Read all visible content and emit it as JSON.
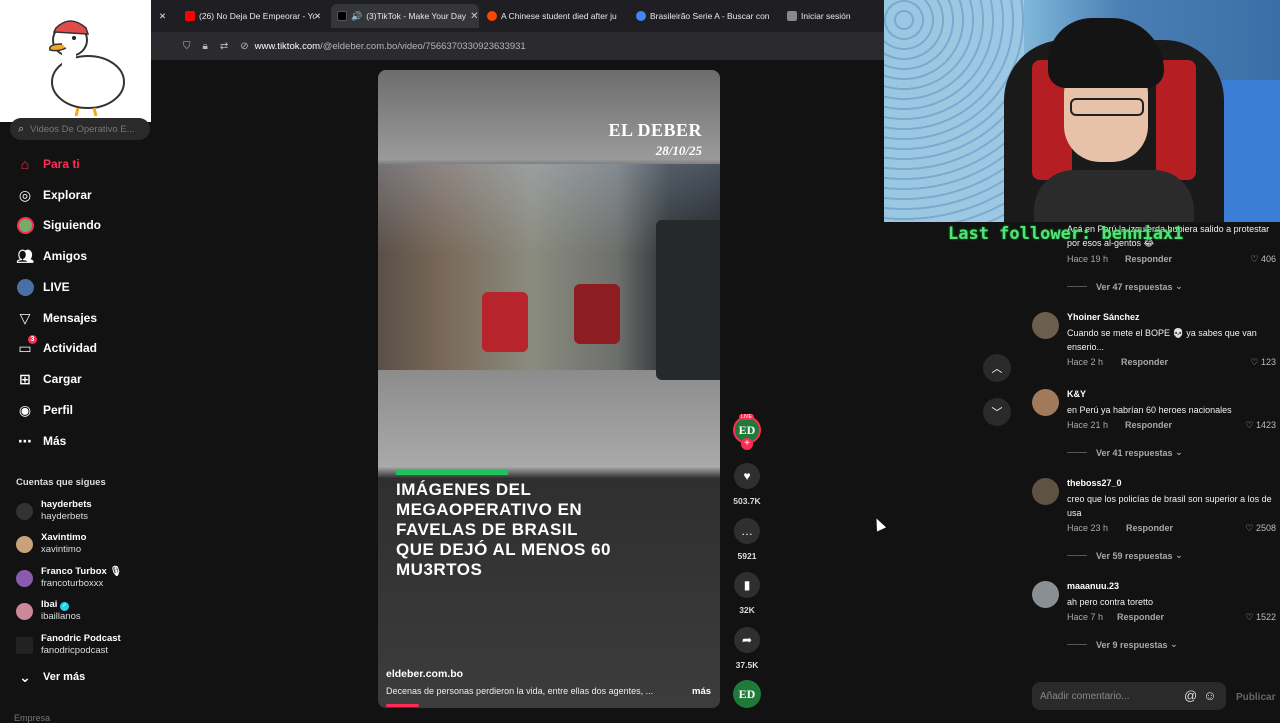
{
  "browser": {
    "tabs": [
      {
        "label": "(26) No Deja De Empeorar - Yo",
        "icon": "youtube-icon",
        "color": "#ff0000"
      },
      {
        "label": "(3)TikTok - Make Your Day",
        "icon": "tiktok-icon",
        "color": "#000000",
        "active": true
      },
      {
        "label": "A Chinese student died after ju",
        "icon": "reddit-icon",
        "color": "#ff4500"
      },
      {
        "label": "Brasileirão Serie A - Buscar con",
        "icon": "google-icon",
        "color": "#4285f4"
      },
      {
        "label": "Iniciar sesión",
        "icon": "kick-icon",
        "color": "#53fc18"
      }
    ],
    "url_host": "www.tiktok.com",
    "url_path": "/@eldeber.com.bo/video/7566370330923633931"
  },
  "sidebar": {
    "search_placeholder": "Videos De Operativo E...",
    "nav": [
      {
        "label": "Para ti",
        "icon": "home-icon",
        "active": true
      },
      {
        "label": "Explorar",
        "icon": "compass-icon"
      },
      {
        "label": "Siguiendo",
        "icon": "following-icon"
      },
      {
        "label": "Amigos",
        "icon": "friends-icon"
      },
      {
        "label": "LIVE",
        "icon": "live-icon"
      },
      {
        "label": "Mensajes",
        "icon": "messages-icon"
      },
      {
        "label": "Actividad",
        "icon": "activity-icon",
        "badge": "3"
      },
      {
        "label": "Cargar",
        "icon": "upload-icon"
      },
      {
        "label": "Perfil",
        "icon": "profile-icon"
      },
      {
        "label": "Más",
        "icon": "more-icon"
      }
    ],
    "following_title": "Cuentas que sigues",
    "following": [
      {
        "name": "hayderbets",
        "handle": "hayderbets"
      },
      {
        "name": "Xavintimo",
        "handle": "xavintimo"
      },
      {
        "name": "Franco Turbox 🎙",
        "handle": "francoturboxxx"
      },
      {
        "name": "Ibai",
        "handle": "ibaillanos",
        "verified": true
      },
      {
        "name": "Fanodric Podcast",
        "handle": "fanodricpodcast"
      }
    ],
    "see_more": "Ver más",
    "footer_cut": "Empresa"
  },
  "video": {
    "brand": "EL DEBER",
    "date": "28/10/25",
    "headline": "IMÁGENES DEL MEGAOPERATIVO EN FAVELAS DE BRASIL QUE DEJÓ AL MENOS 60 MU3RTOS",
    "source": "eldeber.com.bo",
    "description": "Decenas de personas perdieron la vida, entre ellas dos agentes, ...",
    "more_label": "más",
    "progress": 0.1
  },
  "actions": {
    "live_badge": "LIVE",
    "avatar_text": "ED",
    "likes": "503.7K",
    "comments": "5921",
    "saves": "32K",
    "shares": "37.5K"
  },
  "overlay": {
    "last_follower": "Last follower: benniax1"
  },
  "comments": [
    {
      "user": "",
      "text": "Acá en Perú la izquierda hubiera salido a protestar por esos al-gentos 😂",
      "time": "Hace 19 h",
      "likes": "406",
      "replies": "Ver 47 respuestas"
    },
    {
      "user": "Yhoiner Sánchez",
      "text": "Cuando se mete el BOPE 💀 ya sabes que van enserio...",
      "time": "Hace 2 h",
      "likes": "123"
    },
    {
      "user": "K&Y",
      "text": "en Perú ya habrían 60 heroes nacionales",
      "time": "Hace 21 h",
      "likes": "1423",
      "replies": "Ver 41 respuestas"
    },
    {
      "user": "theboss27_0",
      "text": "creo que los policías de brasil son superior a los de usa",
      "time": "Hace 23 h",
      "likes": "2508",
      "replies": "Ver 59 respuestas"
    },
    {
      "user": "maaanuu.23",
      "text": "ah pero contra toretto",
      "time": "Hace 7 h",
      "likes": "1522",
      "replies": "Ver 9 respuestas"
    }
  ],
  "reply_label": "Responder",
  "comment_input": {
    "placeholder": "Añadir comentario...",
    "publish": "Publicar"
  }
}
